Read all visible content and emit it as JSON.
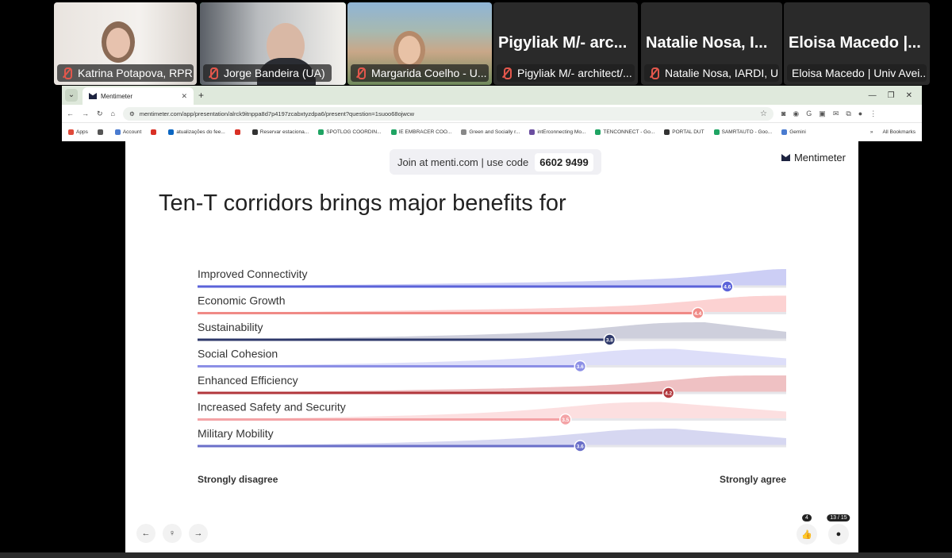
{
  "participants": [
    {
      "name": "Katrina Potapova, RPR",
      "video": true,
      "active": false
    },
    {
      "name": "Jorge Bandeira (UA)",
      "video": true,
      "active": true
    },
    {
      "name": "Margarida Coelho - U...",
      "video": true,
      "active": false
    },
    {
      "name": "Pigyliak M/- architect/...",
      "big_name": "Pigyliak M/- arc...",
      "video": false,
      "active": false
    },
    {
      "name": "Natalie Nosa, IARDI, U...",
      "big_name": "Natalie Nosa, I...",
      "video": false,
      "active": false
    },
    {
      "name": "Eloisa Macedo | Univ Avei...",
      "big_name": "Eloisa Macedo |...",
      "video": false,
      "active": false
    }
  ],
  "browser": {
    "tab_title": "Mentimeter",
    "new_tab": "+",
    "url": "mentimeter.com/app/presentation/alrck9itnppa8d7p4197zcabxtyzdpa6/present?question=1suoo68ojwcw",
    "bookmarks": [
      {
        "label": "Apps",
        "color": "#e04a3a"
      },
      {
        "label": "",
        "color": "#555555"
      },
      {
        "label": "Account",
        "color": "#4a7bd0"
      },
      {
        "label": "",
        "color": "#d93025"
      },
      {
        "label": "atualizações do fee...",
        "color": "#0a66c2"
      },
      {
        "label": "",
        "color": "#d93025"
      },
      {
        "label": "Reservar estaciona...",
        "color": "#333333"
      },
      {
        "label": "SPOTLOG COORDIN...",
        "color": "#1fa463"
      },
      {
        "label": "IE EMBRACER  COO...",
        "color": "#1fa463"
      },
      {
        "label": "Green and Socially r...",
        "color": "#888888"
      },
      {
        "label": "intErconnecting Mo...",
        "color": "#6b4ea0"
      },
      {
        "label": "TENCONNECT - Go...",
        "color": "#1fa463"
      },
      {
        "label": "PORTAL DUT",
        "color": "#333333"
      },
      {
        "label": "SAMRTAUTO - Goo...",
        "color": "#1fa463"
      },
      {
        "label": "Gemini",
        "color": "#4a7bd0"
      }
    ],
    "more_bookmarks": "»",
    "all_bookmarks": "All Bookmarks"
  },
  "slide": {
    "join_text": "Join at menti.com | use code",
    "join_code": "6602 9499",
    "brand": "Mentimeter",
    "title": "Ten-T corridors brings major benefits for",
    "scale_min_label": "Strongly disagree",
    "scale_max_label": "Strongly agree",
    "likes": "4",
    "counter": "13 / 15"
  },
  "chart_data": {
    "type": "scale",
    "scale_range": [
      1,
      5
    ],
    "statements": [
      {
        "label": "Improved Connectivity",
        "average": 4.6,
        "color": "#5b63d9",
        "area": "#c3c6f3"
      },
      {
        "label": "Economic Growth",
        "average": 4.4,
        "color": "#f08a86",
        "area": "#fbcaca"
      },
      {
        "label": "Sustainability",
        "average": 3.8,
        "color": "#2f3a6b",
        "area": "#c5c7d6"
      },
      {
        "label": "Social Cohesion",
        "average": 3.6,
        "color": "#8c8fe6",
        "area": "#d7d8f8"
      },
      {
        "label": "Enhanced Efficiency",
        "average": 4.2,
        "color": "#b2373c",
        "area": "#ecb6b8"
      },
      {
        "label": "Increased Safety and Security",
        "average": 3.5,
        "color": "#f4a3a6",
        "area": "#fcd9da"
      },
      {
        "label": "Military Mobility",
        "average": 3.6,
        "color": "#6a6fc9",
        "area": "#cfd0ef"
      }
    ]
  }
}
